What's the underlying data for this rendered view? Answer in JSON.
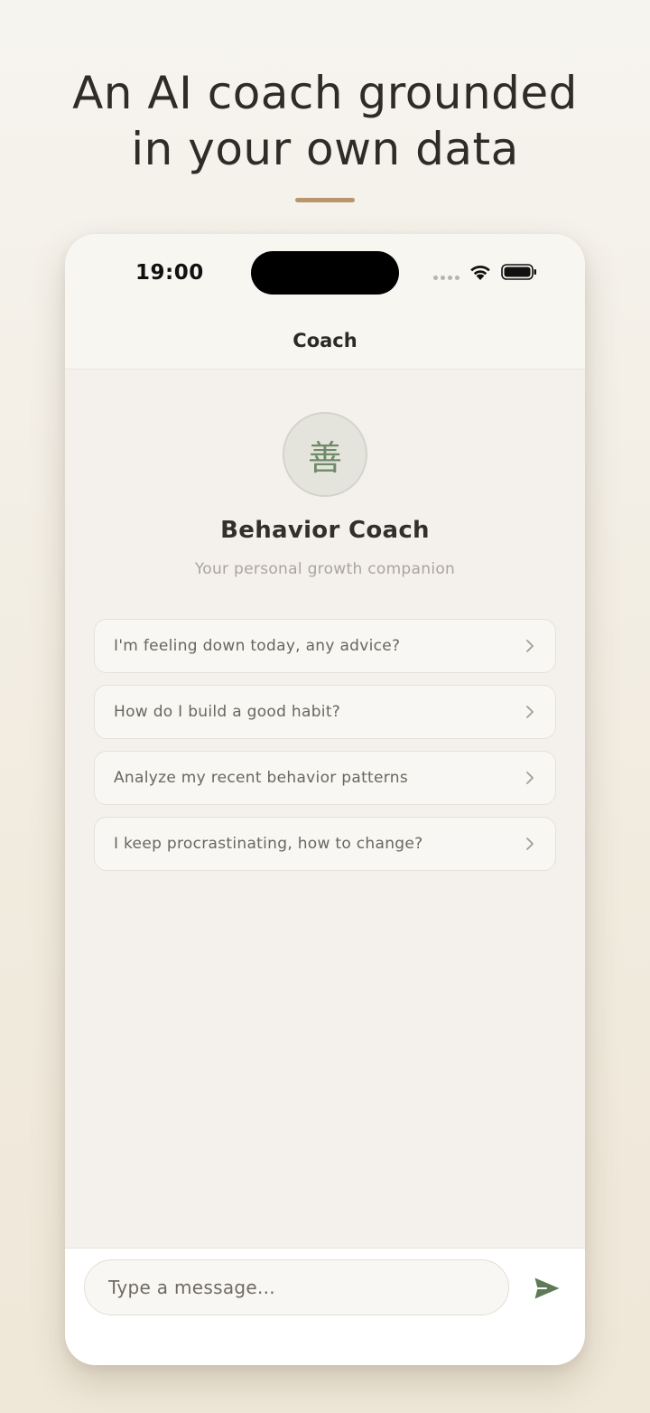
{
  "headline": {
    "line1": "An AI coach grounded",
    "line2": "in your own data"
  },
  "colors": {
    "accent_rule": "#b8956a",
    "send_icon": "#5e7a57",
    "avatar_glyph": "#6e8a68"
  },
  "status_bar": {
    "time": "19:00",
    "icons": [
      "signal-dots-icon",
      "wifi-icon",
      "battery-icon"
    ]
  },
  "nav": {
    "title": "Coach"
  },
  "coach": {
    "avatar_glyph": "善",
    "name": "Behavior Coach",
    "subtitle": "Your personal growth companion"
  },
  "suggestions": [
    {
      "label": "I'm feeling down today, any advice?"
    },
    {
      "label": "How do I build a good habit?"
    },
    {
      "label": "Analyze my recent behavior patterns"
    },
    {
      "label": "I keep procrastinating, how to change?"
    }
  ],
  "composer": {
    "placeholder": "Type a message...",
    "value": "",
    "send_icon": "send-icon"
  }
}
